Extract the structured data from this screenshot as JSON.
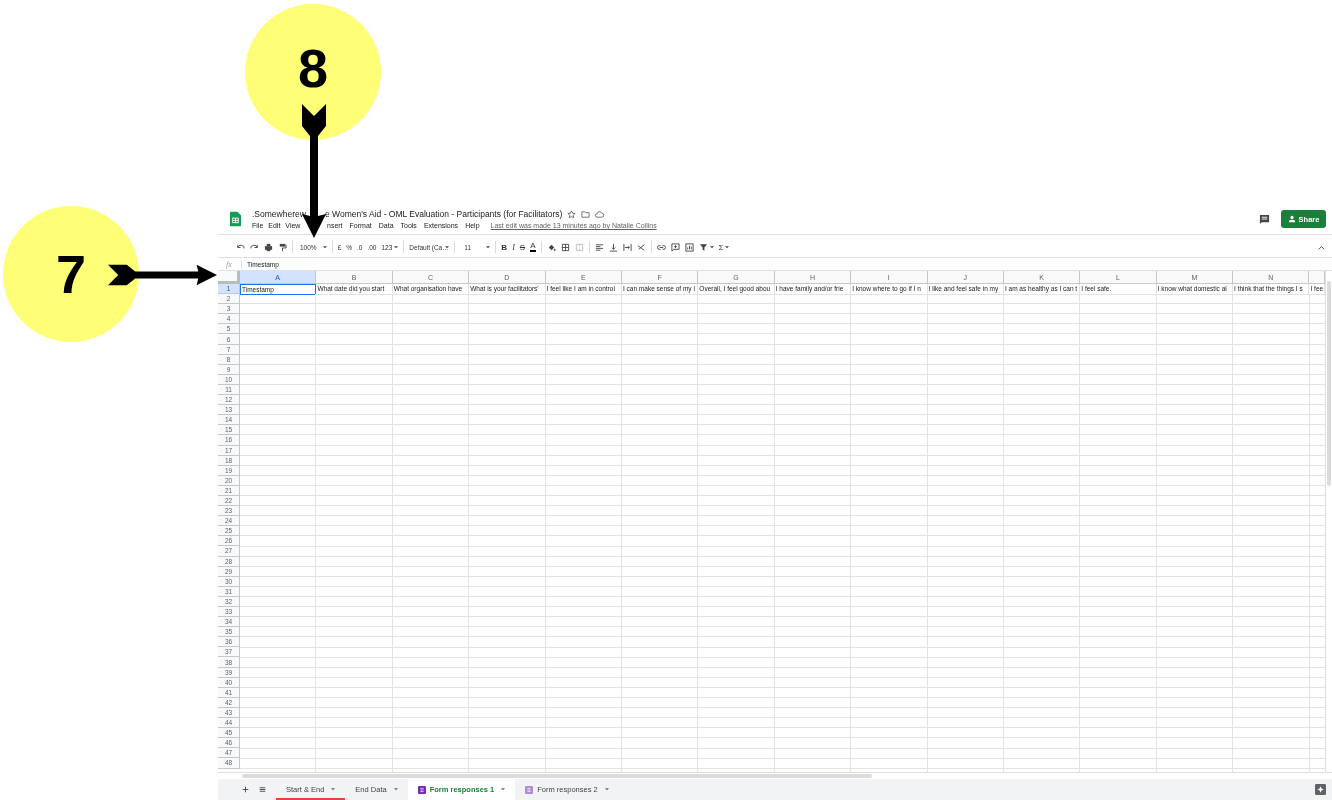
{
  "annotations": [
    {
      "label": "8",
      "kind": "down_arrow"
    },
    {
      "label": "7",
      "kind": "right_arrow"
    }
  ],
  "document": {
    "title_parts": [
      ".Somewherew",
      "e Women's Aid - OML Evaluation - Participants (for Facilitators)"
    ]
  },
  "menu": [
    "File",
    "Edit",
    "View",
    "nsert",
    "Format",
    "Data",
    "Tools",
    "Extensions",
    "Help"
  ],
  "last_edit": "Last edit was made 13 minutes ago by Natalie Collins",
  "share_button": "Share",
  "toolbar": {
    "zoom": "100%",
    "currency": "£",
    "percent": "%",
    "decimals_less": ".0",
    "decimals_more": ".00",
    "number_formats": "123",
    "font": "Default (Ca…",
    "font_size": "11",
    "bold": "B",
    "italic": "I",
    "strikethrough": "S",
    "text_color": "A",
    "functions": "Σ"
  },
  "formula_bar": {
    "label": "fx",
    "value": "Timestamp"
  },
  "grid": {
    "columns": [
      "A",
      "B",
      "C",
      "D",
      "E",
      "F",
      "G",
      "H",
      "I",
      "J",
      "K",
      "L",
      "M",
      "N"
    ],
    "row_numbers": [
      "1",
      "2",
      "3",
      "4",
      "5",
      "6",
      "7",
      "8",
      "9",
      "10",
      "11",
      "12",
      "13",
      "14",
      "15",
      "16",
      "17",
      "18",
      "19",
      "20",
      "21",
      "22",
      "23",
      "24",
      "25",
      "26",
      "27",
      "28",
      "29",
      "30",
      "31",
      "32",
      "33",
      "34",
      "35",
      "36",
      "37",
      "38",
      "39",
      "40",
      "41",
      "42",
      "43",
      "44",
      "45",
      "46",
      "47",
      "48"
    ],
    "first_row": [
      {
        "text": "Timestamp",
        "selected": true
      },
      {
        "text": "What date did you start",
        "selected": false
      },
      {
        "text": "What organisation have",
        "selected": false
      },
      {
        "text": "What is your facilitators'",
        "selected": false
      },
      {
        "text": "I feel like I am in control",
        "selected": false
      },
      {
        "text": "I can make sense of my l",
        "selected": false
      },
      {
        "text": "Overall, I feel good abou",
        "selected": false
      },
      {
        "text": "I have family and/or frie",
        "selected": false
      },
      {
        "text": "I know where to go if I n",
        "selected": false
      },
      {
        "text": "I like and feel safe in my",
        "selected": false
      },
      {
        "text": "I am as healthy as I can t",
        "selected": false
      },
      {
        "text": "I feel safe.",
        "selected": false
      },
      {
        "text": "I know what domestic al",
        "selected": false
      },
      {
        "text": "I think that the things I s",
        "selected": false
      },
      {
        "text": "I fee",
        "selected": false
      }
    ]
  },
  "sheet_tabs": [
    {
      "label": "Start & End",
      "kind": "sheet",
      "selected": false,
      "color": "#ea4335"
    },
    {
      "label": "End Data",
      "kind": "sheet",
      "selected": false
    },
    {
      "label": "Form responses 1",
      "kind": "form",
      "selected": true
    },
    {
      "label": "Form responses 2",
      "kind": "form",
      "selected": false
    }
  ]
}
